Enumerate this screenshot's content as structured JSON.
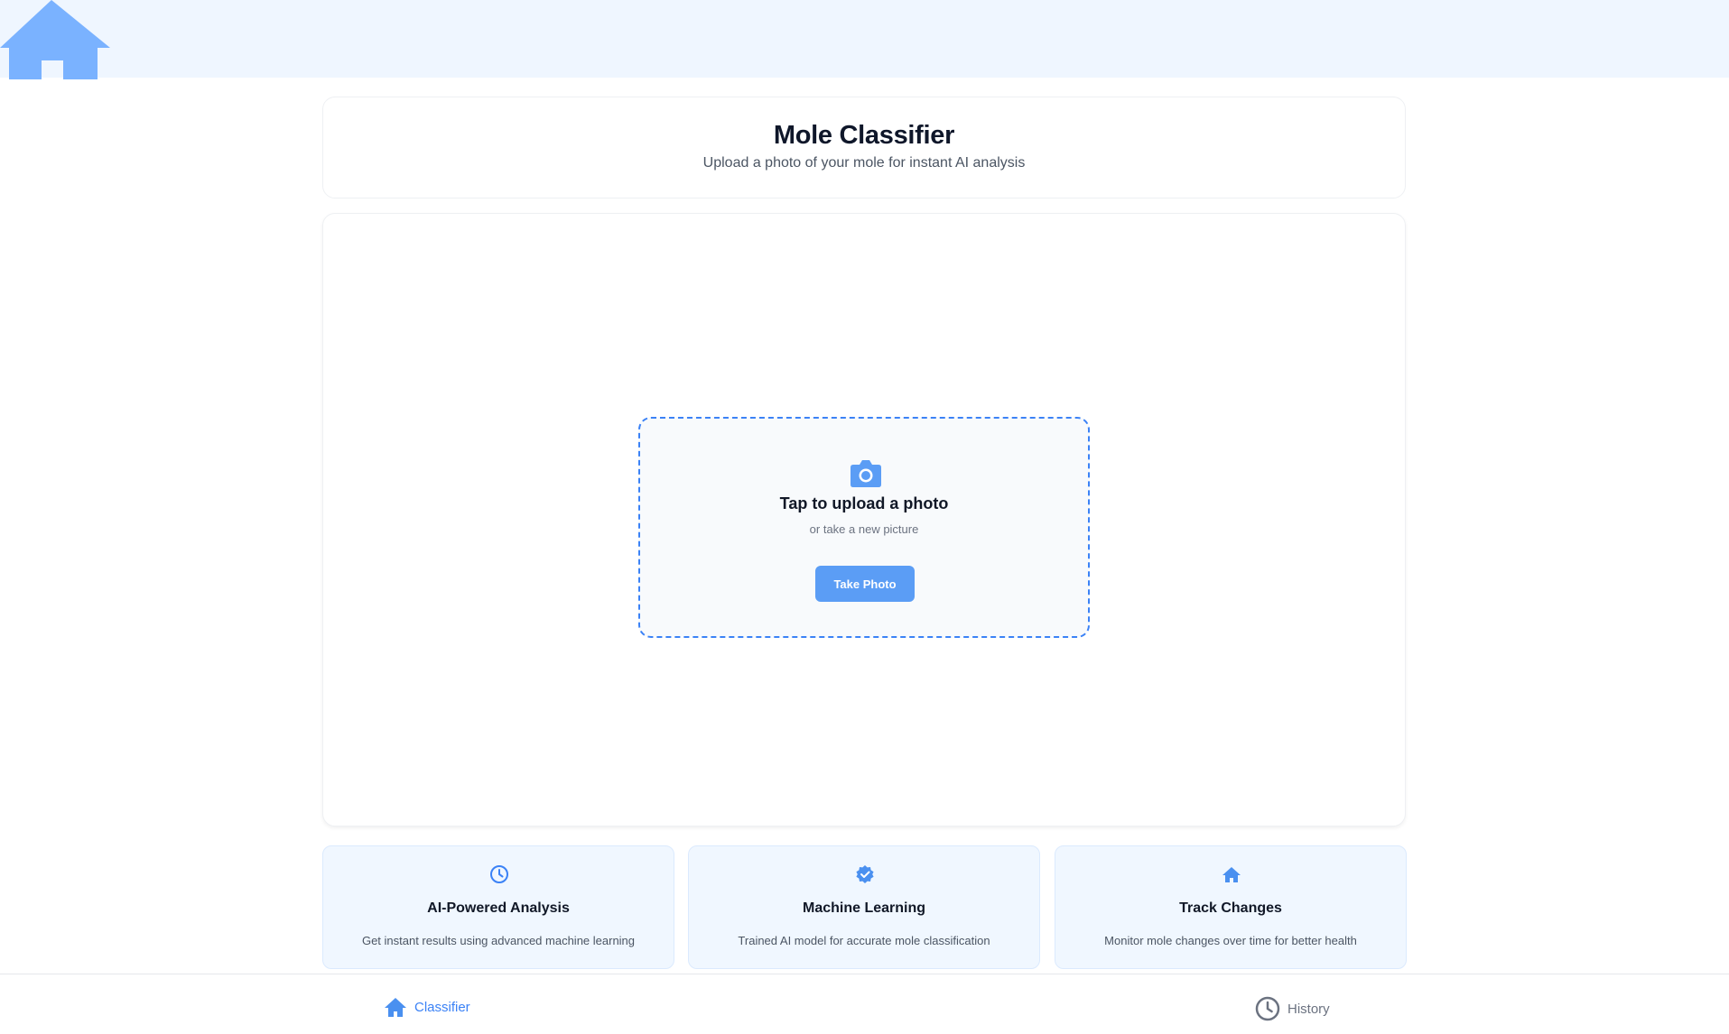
{
  "colors": {
    "accent": "#5b9df5",
    "topbar_bg": "#eff6ff",
    "feature_bg": "#f0f7ff",
    "upload_border": "#3b82f6"
  },
  "topbar": {
    "logo_icon": "home-icon"
  },
  "header": {
    "title": "Mole Classifier",
    "subtitle": "Upload a photo of your mole for instant AI analysis"
  },
  "upload": {
    "icon": "camera-icon",
    "title": "Tap to upload a photo",
    "subtitle": "or take a new picture",
    "button_label": "Take Photo"
  },
  "features": [
    {
      "icon": "clock-icon",
      "title": "AI-Powered Analysis",
      "description": "Get instant results using advanced machine learning"
    },
    {
      "icon": "verified-badge-icon",
      "title": "Machine Learning",
      "description": "Trained AI model for accurate mole classification"
    },
    {
      "icon": "home-icon",
      "title": "Track Changes",
      "description": "Monitor mole changes over time for better health"
    }
  ],
  "nav": {
    "items": [
      {
        "icon": "home-icon",
        "label": "Classifier",
        "active": true
      },
      {
        "icon": "clock-icon",
        "label": "History",
        "active": false
      }
    ]
  }
}
